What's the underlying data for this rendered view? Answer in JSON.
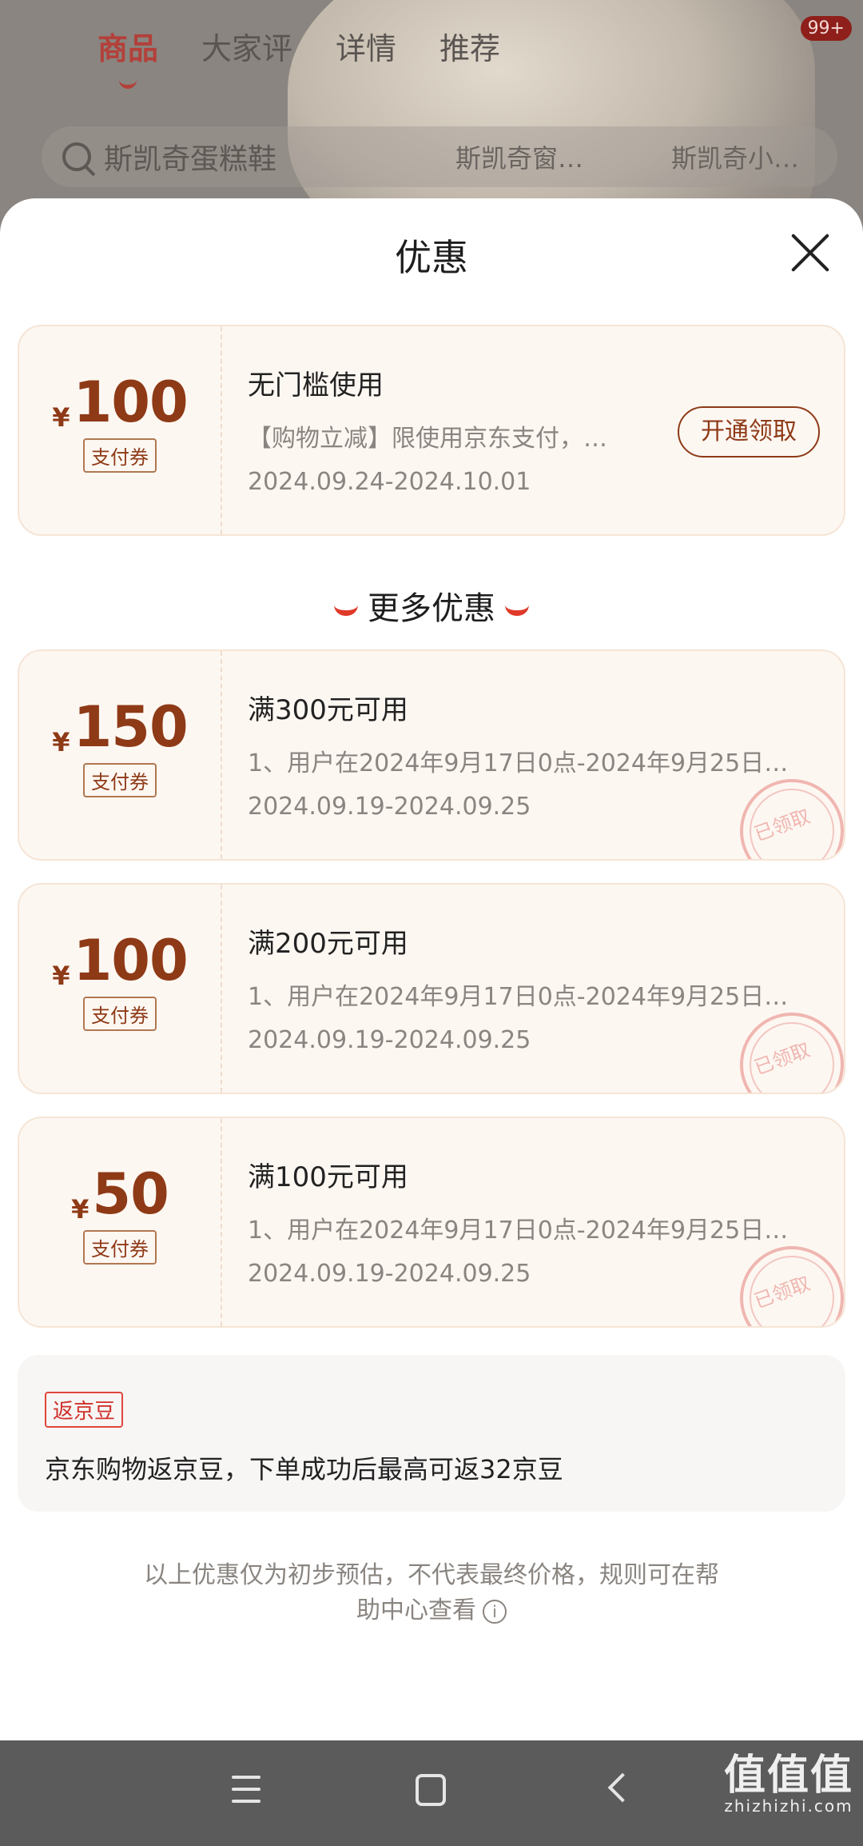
{
  "background": {
    "tabs": [
      "商品",
      "大家评",
      "详情",
      "推荐"
    ],
    "active_tab": 0,
    "badge": "99+",
    "search_query": "斯凯奇蛋糕鞋",
    "search_tags": [
      "斯凯奇窗…",
      "斯凯奇小…"
    ]
  },
  "sheet": {
    "title": "优惠",
    "main_coupon": {
      "yen": "¥",
      "amount": "100",
      "tag": "支付券",
      "title": "无门槛使用",
      "desc": "【购物立减】限使用京东支付，…",
      "date": "2024.09.24-2024.10.01",
      "button": "开通领取"
    },
    "more_title": "更多优惠",
    "more_coupons": [
      {
        "yen": "¥",
        "amount": "150",
        "tag": "支付券",
        "title": "满300元可用",
        "desc": "1、用户在2024年9月17日0点-2024年9月25日…",
        "date": "2024.09.19-2024.09.25",
        "stamp": "已领取"
      },
      {
        "yen": "¥",
        "amount": "100",
        "tag": "支付券",
        "title": "满200元可用",
        "desc": "1、用户在2024年9月17日0点-2024年9月25日…",
        "date": "2024.09.19-2024.09.25",
        "stamp": "已领取"
      },
      {
        "yen": "¥",
        "amount": "50",
        "tag": "支付券",
        "title": "满100元可用",
        "desc": "1、用户在2024年9月17日0点-2024年9月25日…",
        "date": "2024.09.19-2024.09.25",
        "stamp": "已领取"
      }
    ],
    "jd_bean": {
      "tag": "返京豆",
      "text": "京东购物返京豆，下单成功后最高可返32京豆"
    },
    "disclaimer_line1": "以上优惠仅为初步预估，不代表最终价格，规则可在帮",
    "disclaimer_line2": "助中心查看",
    "info_icon": "i"
  },
  "watermark": {
    "main": "值值值",
    "sub": "zhizhizhi.com"
  },
  "colors": {
    "accent": "#8e3a16",
    "brand_red": "#e03a2a",
    "coupon_bg": "#fdf7f2"
  }
}
